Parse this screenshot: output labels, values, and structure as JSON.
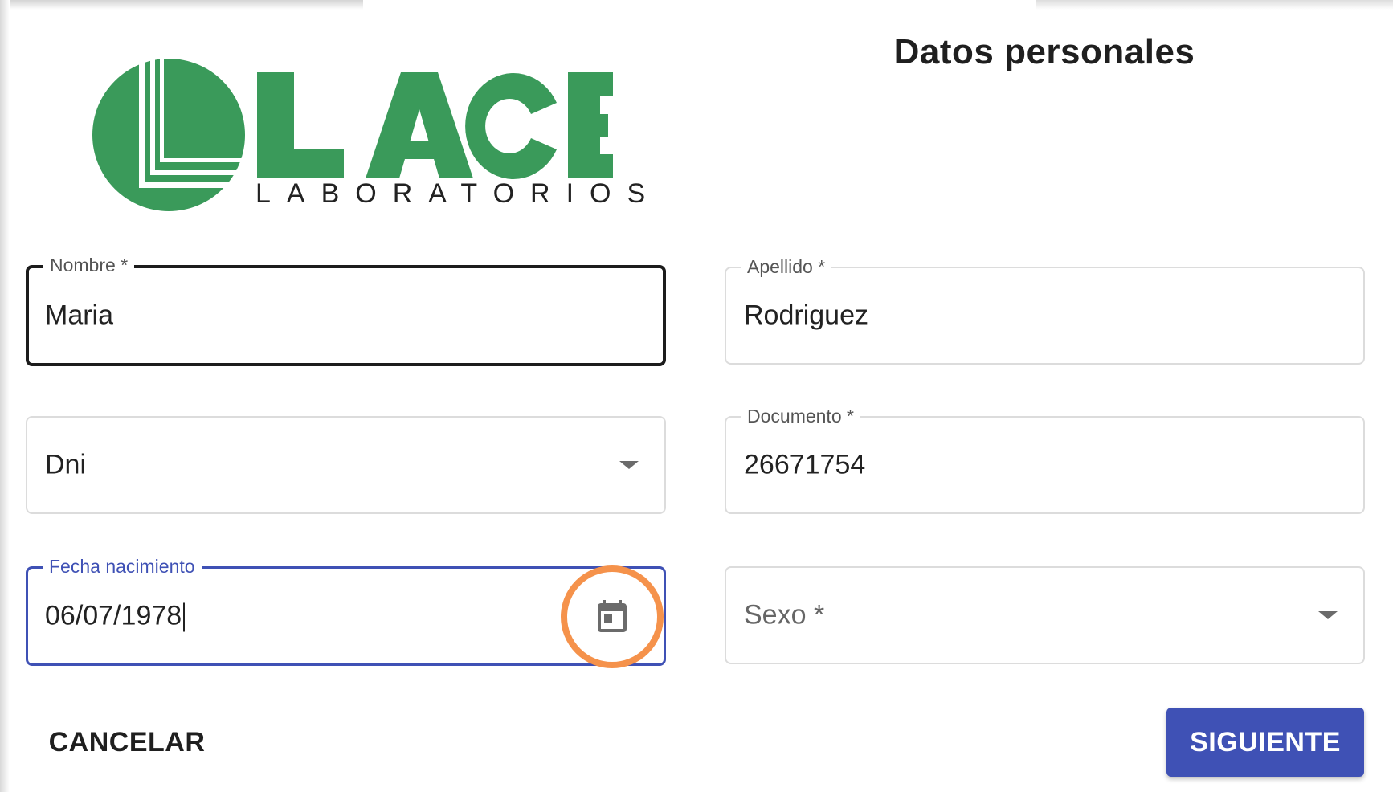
{
  "header": {
    "title": "Datos personales",
    "logo": {
      "brand": "LACE",
      "subtitle": "LABORATORIOS",
      "color": "#3a9a5a"
    }
  },
  "form": {
    "nombre": {
      "label": "Nombre *",
      "value": "Maria"
    },
    "apellido": {
      "label": "Apellido *",
      "value": "Rodriguez"
    },
    "tipo_documento": {
      "value": "Dni"
    },
    "documento": {
      "label": "Documento *",
      "value": "26671754"
    },
    "fecha_nacimiento": {
      "label": "Fecha nacimiento",
      "value": "06/07/1978",
      "icon": "calendar-icon"
    },
    "sexo": {
      "placeholder": "Sexo *"
    }
  },
  "actions": {
    "cancel_label": "CANCELAR",
    "next_label": "SIGUIENTE"
  },
  "colors": {
    "primary": "#3f51b5",
    "highlight": "#f5924b",
    "logo_green": "#3a9a5a"
  }
}
